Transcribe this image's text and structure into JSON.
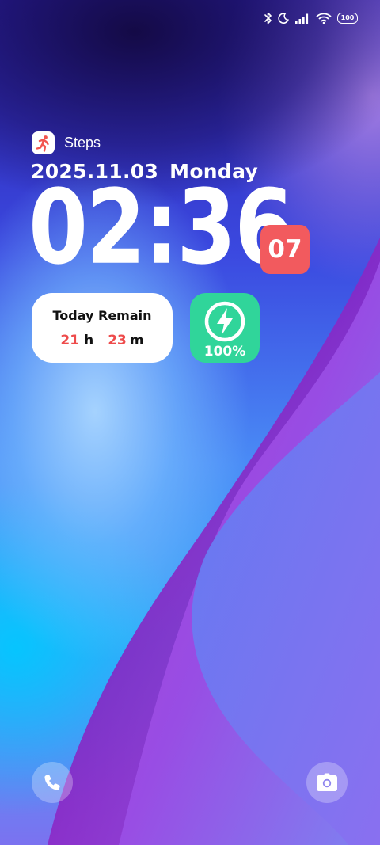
{
  "status_bar": {
    "icons": [
      "bluetooth-icon",
      "moon-icon",
      "signal-icon",
      "wifi-icon",
      "battery-icon"
    ],
    "battery_level": "100"
  },
  "steps": {
    "icon": "running-person-icon",
    "label": "Steps"
  },
  "date": {
    "date": "2025.11.03",
    "weekday": "Monday"
  },
  "clock": {
    "time": "02:36",
    "seconds": "07"
  },
  "today_remain": {
    "title": "Today Remain",
    "hours": "21",
    "hours_unit": "h",
    "minutes": "23",
    "minutes_unit": "m"
  },
  "battery_widget": {
    "icon": "charging-bolt-icon",
    "percent": "100%"
  },
  "shortcuts": {
    "left": "phone-icon",
    "right": "camera-icon"
  },
  "colors": {
    "seconds_badge": "#f25a5e",
    "battery_widget": "#30d59a",
    "remain_numbers": "#ee4b4b",
    "steps_icon": "#f2564f"
  }
}
